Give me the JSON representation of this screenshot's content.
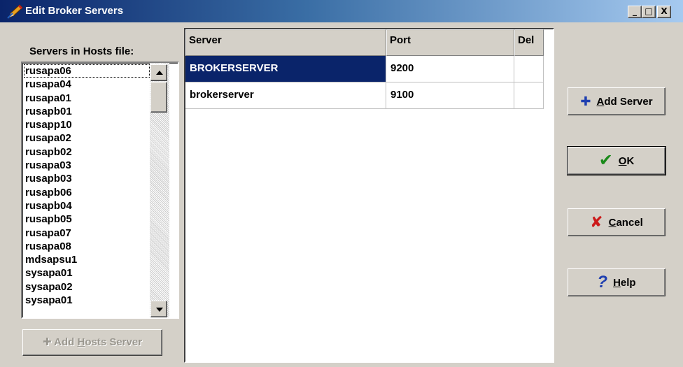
{
  "window": {
    "title": "Edit Broker Servers",
    "controls": {
      "minimize": "_",
      "maximize": "□",
      "close": "X"
    }
  },
  "hosts": {
    "label": "Servers in Hosts file:",
    "items": [
      "rusapa06",
      "rusapa04",
      "rusapa01",
      "rusapb01",
      "rusapp10",
      "rusapa02",
      "rusapb02",
      "rusapa03",
      "rusapb03",
      "rusapb06",
      "rusapb04",
      "rusapb05",
      "rusapa07",
      "rusapa08",
      "mdsapsu1",
      "sysapa01",
      "sysapa02",
      "sysapa01"
    ],
    "add_button": {
      "prefix": "Add ",
      "underlined": "H",
      "suffix": "osts Server",
      "icon": "plus-icon"
    }
  },
  "grid": {
    "columns": [
      "Server",
      "Port",
      "Del"
    ],
    "rows": [
      {
        "server": "BROKERSERVER",
        "port": "9200",
        "del": "",
        "selected": true
      },
      {
        "server": "brokerserver",
        "port": "9100",
        "del": "",
        "selected": false
      }
    ]
  },
  "buttons": {
    "add_server": {
      "underlined": "A",
      "rest": "dd Server",
      "icon": "plus-icon"
    },
    "ok": {
      "underlined": "O",
      "rest": "K",
      "icon": "checkmark-icon"
    },
    "cancel": {
      "underlined": "C",
      "rest": "ancel",
      "icon": "x-icon"
    },
    "help": {
      "underlined": "H",
      "rest": "elp",
      "icon": "question-icon"
    }
  },
  "colors": {
    "titlebar_start": "#0a246a",
    "selection": "#0a246a",
    "face": "#d4d0c8",
    "ok_check": "#1a8a1a",
    "cancel_x": "#cc1a1a",
    "plus_blue": "#1f3fb0",
    "help_blue": "#1f3fb0"
  }
}
